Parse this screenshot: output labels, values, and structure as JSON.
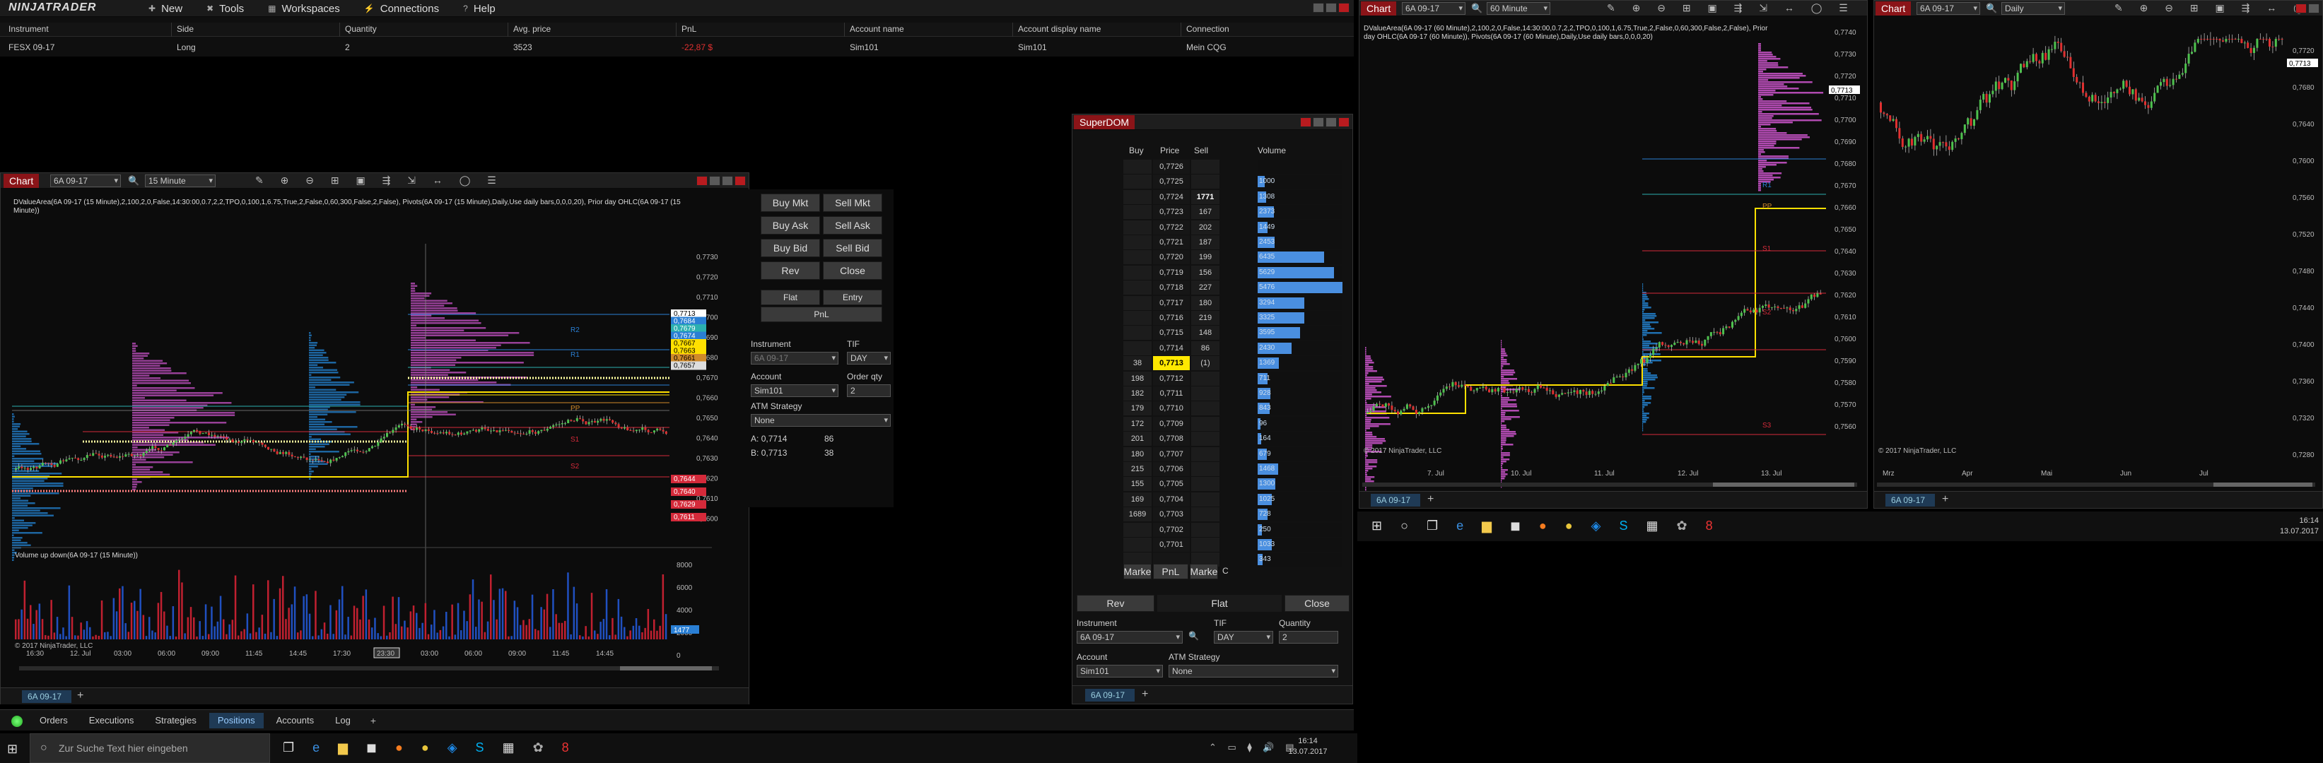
{
  "menubar": {
    "logo": "NINJATRADER",
    "items": [
      {
        "label": "New"
      },
      {
        "label": "Tools"
      },
      {
        "label": "Workspaces"
      },
      {
        "label": "Connections"
      },
      {
        "label": "Help"
      }
    ]
  },
  "positions": {
    "headers": [
      "Instrument",
      "Side",
      "Quantity",
      "Avg. price",
      "PnL",
      "Account name",
      "Account display name",
      "Connection"
    ],
    "row": [
      "FESX 09-17",
      "Long",
      "2",
      "3523",
      "-22,87 $",
      "Sim101",
      "Sim101",
      "Mein CQG"
    ]
  },
  "chart1": {
    "tag": "Chart",
    "instrument": "6A 09-17",
    "interval": "15 Minute",
    "indicators": "DValueArea(6A 09-17 (15 Minute),2,100,2,0,False,14:30:00,0.7,2,2,TPO,0,100,1,6.75,True,2,False,0,60,300,False,2,False), Pivots(6A 09-17 (15 Minute),Daily,Use daily bars,0,0,0,20), Prior day OHLC(6A 09-17 (15 Minute))",
    "price_axis": [
      "0,7730",
      "0,7720",
      "0,7710",
      "0,7700",
      "0,7690",
      "0,7680",
      "0,7670",
      "0,7660",
      "0,7650",
      "0,7640",
      "0,7630",
      "0,7620",
      "0,7610",
      "0,7600"
    ],
    "price_markers": [
      {
        "v": "0,7713",
        "c": "#ffffff",
        "fg": "#000"
      },
      {
        "v": "0,7684",
        "c": "#2a7fd4",
        "fg": "#fff"
      },
      {
        "v": "0,7679",
        "c": "#2bb0b0",
        "fg": "#fff"
      },
      {
        "v": "0,7674",
        "c": "#2a7fd4",
        "fg": "#fff"
      },
      {
        "v": "0,7667",
        "c": "#ffe000",
        "fg": "#000"
      },
      {
        "v": "0,7663",
        "c": "#ffe000",
        "fg": "#000"
      },
      {
        "v": "0,7661",
        "c": "#d08a2a",
        "fg": "#000"
      },
      {
        "v": "0,7657",
        "c": "#dddddd",
        "fg": "#000"
      },
      {
        "v": "0,7644",
        "c": "#d42a3a",
        "fg": "#fff"
      },
      {
        "v": "0,7640",
        "c": "#d42a3a",
        "fg": "#fff"
      },
      {
        "v": "0,7629",
        "c": "#d42a3a",
        "fg": "#fff"
      },
      {
        "v": "0,7611",
        "c": "#d42a3a",
        "fg": "#fff"
      }
    ],
    "level_labels": [
      "R2",
      "R1",
      "PP",
      "S1",
      "S2"
    ],
    "volume_title": "Volume up down(6A 09-17 (15 Minute))",
    "vol_axis": [
      "8000",
      "6000",
      "4000",
      "2000",
      "0"
    ],
    "vol_marker": "1477",
    "copyright": "© 2017 NinjaTrader, LLC",
    "time_axis": [
      "16:30",
      "12. Jul",
      "03:00",
      "06:00",
      "09:00",
      "11:45",
      "14:45",
      "17:30",
      "23:30",
      "03:00",
      "06:00",
      "09:00",
      "11:45",
      "14:45"
    ],
    "time_cursor": "23:30",
    "tab": "6A 09-17"
  },
  "chart_trader": {
    "buy_mkt": "Buy Mkt",
    "sell_mkt": "Sell Mkt",
    "buy_ask": "Buy Ask",
    "sell_ask": "Sell Ask",
    "buy_bid": "Buy Bid",
    "sell_bid": "Sell Bid",
    "rev": "Rev",
    "close": "Close",
    "flat": "Flat",
    "entry": "Entry",
    "pnl": "PnL",
    "instrument_label": "Instrument",
    "instrument": "6A 09-17",
    "tif_label": "TIF",
    "tif": "DAY",
    "account_label": "Account",
    "account": "Sim101",
    "qty_label": "Order qty",
    "qty": "2",
    "atm_label": "ATM Strategy",
    "atm": "None",
    "a_label": "A:",
    "a_price": "0,7714",
    "a_qty": "86",
    "b_label": "B:",
    "b_price": "0,7713",
    "b_qty": "38"
  },
  "superdom": {
    "title": "SuperDOM",
    "headers": {
      "buy": "Buy",
      "price": "Price",
      "sell": "Sell",
      "volume": "Volume"
    },
    "rows": [
      {
        "buy": "",
        "price": "0,7726",
        "sell": "",
        "vol": "",
        "w": 0
      },
      {
        "buy": "",
        "price": "0,7725",
        "sell": "",
        "vol": "1000",
        "w": 0.08
      },
      {
        "buy": "",
        "price": "0,7724",
        "sell": "1771",
        "vol": "1308",
        "w": 0.1
      },
      {
        "buy": "",
        "price": "0,7723",
        "sell": "167",
        "vol": "2373",
        "w": 0.19
      },
      {
        "buy": "",
        "price": "0,7722",
        "sell": "202",
        "vol": "1449",
        "w": 0.12
      },
      {
        "buy": "",
        "price": "0,7721",
        "sell": "187",
        "vol": "2453",
        "w": 0.2
      },
      {
        "buy": "",
        "price": "0,7720",
        "sell": "199",
        "vol": "6435",
        "w": 0.78
      },
      {
        "buy": "",
        "price": "0,7719",
        "sell": "156",
        "vol": "5629",
        "w": 0.9
      },
      {
        "buy": "",
        "price": "0,7718",
        "sell": "227",
        "vol": "5476",
        "w": 1.0
      },
      {
        "buy": "",
        "price": "0,7717",
        "sell": "180",
        "vol": "3294",
        "w": 0.55
      },
      {
        "buy": "",
        "price": "0,7716",
        "sell": "219",
        "vol": "3325",
        "w": 0.55
      },
      {
        "buy": "",
        "price": "0,7715",
        "sell": "148",
        "vol": "3595",
        "w": 0.5
      },
      {
        "buy": "",
        "price": "0,7714",
        "sell": "86",
        "vol": "2430",
        "w": 0.4
      },
      {
        "buy": "38",
        "price": "0,7713",
        "sell": "(1)",
        "vol": "1369",
        "w": 0.25,
        "cur": true
      },
      {
        "buy": "198",
        "price": "0,7712",
        "sell": "",
        "vol": "711",
        "w": 0.12
      },
      {
        "buy": "182",
        "price": "0,7711",
        "sell": "",
        "vol": "928",
        "w": 0.15
      },
      {
        "buy": "179",
        "price": "0,7710",
        "sell": "",
        "vol": "843",
        "w": 0.14
      },
      {
        "buy": "172",
        "price": "0,7709",
        "sell": "",
        "vol": "96",
        "w": 0.03
      },
      {
        "buy": "201",
        "price": "0,7708",
        "sell": "",
        "vol": "164",
        "w": 0.04
      },
      {
        "buy": "180",
        "price": "0,7707",
        "sell": "",
        "vol": "679",
        "w": 0.11
      },
      {
        "buy": "215",
        "price": "0,7706",
        "sell": "",
        "vol": "1468",
        "w": 0.24
      },
      {
        "buy": "155",
        "price": "0,7705",
        "sell": "",
        "vol": "1300",
        "w": 0.21
      },
      {
        "buy": "169",
        "price": "0,7704",
        "sell": "",
        "vol": "1025",
        "w": 0.17
      },
      {
        "buy": "1689",
        "price": "0,7703",
        "sell": "",
        "vol": "728",
        "w": 0.12
      },
      {
        "buy": "",
        "price": "0,7702",
        "sell": "",
        "vol": "250",
        "w": 0.05
      },
      {
        "buy": "",
        "price": "0,7701",
        "sell": "",
        "vol": "1033",
        "w": 0.17
      },
      {
        "buy": "",
        "price": "",
        "sell": "",
        "vol": "343",
        "w": 0.06
      }
    ],
    "foot": {
      "market": "Marke",
      "pnl": "PnL",
      "market2": "Marke",
      "c": "C"
    },
    "rev": "Rev",
    "flat": "Flat",
    "close": "Close",
    "instrument_label": "Instrument",
    "instrument": "6A 09-17",
    "tif_label": "TIF",
    "tif": "DAY",
    "qty_label": "Quantity",
    "qty": "2",
    "account_label": "Account",
    "account": "Sim101",
    "atm_label": "ATM Strategy",
    "atm": "None",
    "tab": "6A 09-17"
  },
  "chart2": {
    "tag": "Chart",
    "instrument": "6A 09-17",
    "interval": "60 Minute",
    "indicators": "DValueArea(6A 09-17 (60 Minute),2,100,2,0,False,14:30:00,0.7,2,2,TPO,0,100,1,6.75,True,2,False,0,60,300,False,2,False), Prior day OHLC(6A 09-17 (60 Minute)), Pivots(6A 09-17 (60 Minute),Daily,Use daily bars,0,0,0,20)",
    "price_axis": [
      "0,7740",
      "0,7730",
      "0,7720",
      "0,7710",
      "0,7700",
      "0,7690",
      "0,7680",
      "0,7670",
      "0,7660",
      "0,7650",
      "0,7640",
      "0,7630",
      "0,7620",
      "0,7610",
      "0,7600",
      "0,7590",
      "0,7580",
      "0,7570",
      "0,7560"
    ],
    "price_marker": "0,7713",
    "time_axis": [
      "7. Jul",
      "10. Jul",
      "11. Jul",
      "12. Jul",
      "13. Jul"
    ],
    "copyright": "© 2017 NinjaTrader, LLC",
    "level_labels": [
      "R1",
      "PP",
      "S1",
      "S2",
      "S3"
    ],
    "tab": "6A 09-17"
  },
  "chart3": {
    "tag": "Chart",
    "instrument": "6A 09-17",
    "interval": "Daily",
    "price_axis": [
      "0,7720",
      "0,7680",
      "0,7640",
      "0,7600",
      "0,7560",
      "0,7520",
      "0,7480",
      "0,7440",
      "0,7400",
      "0,7360",
      "0,7320",
      "0,7280"
    ],
    "price_marker": "0,7713",
    "time_axis": [
      "Mrz",
      "Apr",
      "Mai",
      "Jun",
      "Jul"
    ],
    "copyright": "© 2017 NinjaTrader, LLC",
    "tab": "6A 09-17",
    "clock_time": "16:14",
    "clock_date": "13.07.2017"
  },
  "bottom_tabs": [
    {
      "label": "Orders"
    },
    {
      "label": "Executions"
    },
    {
      "label": "Strategies"
    },
    {
      "label": "Positions",
      "active": true
    },
    {
      "label": "Accounts"
    },
    {
      "label": "Log"
    }
  ],
  "taskbar": {
    "search_placeholder": "Zur Suche Text hier eingeben",
    "time": "16:14",
    "date": "13.07.2017"
  }
}
